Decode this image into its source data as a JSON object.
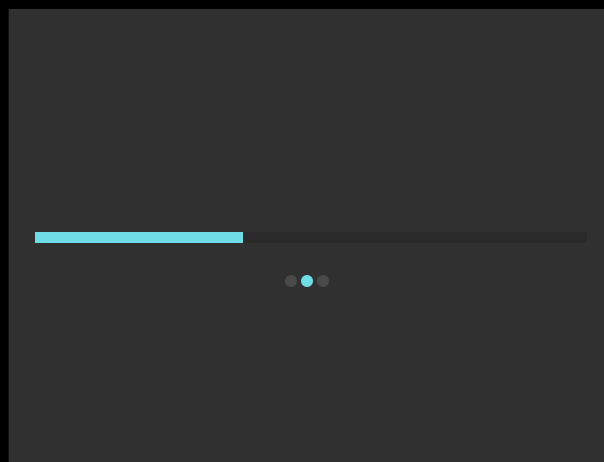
{
  "colors": {
    "background": "#303030",
    "track": "#2a2a2a",
    "accent": "#6fdde6",
    "inactive_dot": "#4a4a4a"
  },
  "loading": {
    "progress_fraction": 0.377,
    "dots_total": 3,
    "active_dot_index": 1
  }
}
